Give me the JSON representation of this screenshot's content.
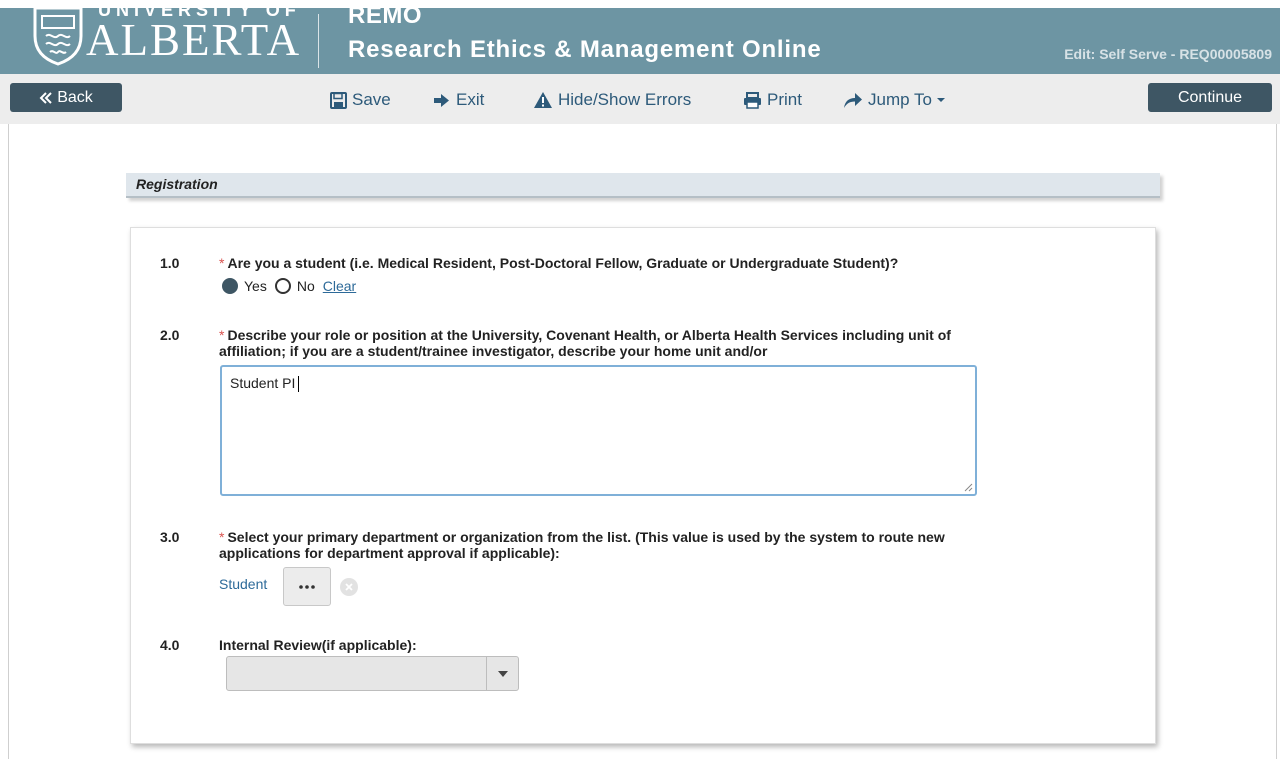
{
  "header": {
    "university_top": "UNIVERSITY OF",
    "university_name": "ALBERTA",
    "app_short": "REMO",
    "app_long": "Research Ethics & Management Online",
    "edit_label": "Edit: Self Serve - REQ00005809"
  },
  "toolbar": {
    "back": "Back",
    "save": "Save",
    "exit": "Exit",
    "errors": "Hide/Show Errors",
    "print": "Print",
    "jump": "Jump To",
    "continue": "Continue"
  },
  "section": {
    "title": "Registration"
  },
  "questions": [
    {
      "number": "1.0",
      "required": "*",
      "text": "Are you a student (i.e. Medical Resident, Post-Doctoral Fellow, Graduate or Undergraduate Student)?",
      "options": [
        "Yes",
        "No"
      ],
      "selected": "Yes",
      "clear_label": "Clear"
    },
    {
      "number": "2.0",
      "required": "*",
      "text_line1": "Describe your role or position at the University, Covenant Health, or Alberta Health Services including unit of",
      "text_line2": "affiliation; if you are a student/trainee investigator, describe your home unit and/or",
      "value": "Student PI"
    },
    {
      "number": "3.0",
      "required": "*",
      "text_line1": "Select your primary department or organization from the list. (This value is used by the system to route new",
      "text_line2": "applications for department approval if applicable):",
      "value": "Student",
      "lookup_label": "..."
    },
    {
      "number": "4.0",
      "text": "Internal Review(if applicable):",
      "value": ""
    }
  ],
  "icons": {
    "back": "double-chevron-left-icon",
    "save": "floppy-disk-icon",
    "exit": "exit-arrow-icon",
    "errors": "warning-triangle-icon",
    "print": "printer-icon",
    "jump": "share-arrow-icon",
    "dropdown": "caret-down-icon",
    "clear": "close-circle-icon"
  },
  "colors": {
    "header_bg": "#6d95a3",
    "button_dark": "#3e5664",
    "link": "#2d6a99",
    "required": "#d9534f",
    "section_bg": "#dfe6ec"
  }
}
